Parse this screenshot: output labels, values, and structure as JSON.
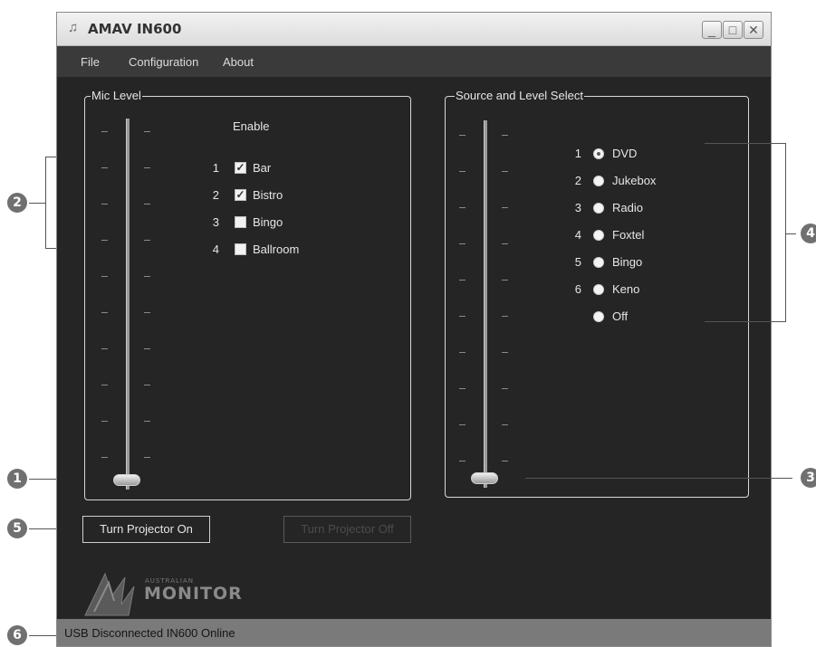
{
  "window": {
    "title": "AMAV IN600",
    "icon": "speaker-icon",
    "controls": [
      "minimize",
      "maximize",
      "close"
    ]
  },
  "menu": [
    "File",
    "Configuration",
    "About"
  ],
  "mic_level": {
    "title": "Mic Level",
    "enable_header": "Enable",
    "level_fraction": 0,
    "channels": [
      {
        "num": "1",
        "label": "Bar",
        "checked": true
      },
      {
        "num": "2",
        "label": "Bistro",
        "checked": true
      },
      {
        "num": "3",
        "label": "Bingo",
        "checked": false
      },
      {
        "num": "4",
        "label": "Ballroom",
        "checked": false
      }
    ]
  },
  "source_level": {
    "title": "Source and Level Select",
    "level_fraction": 0,
    "sources": [
      {
        "num": "1",
        "label": "DVD",
        "selected": true
      },
      {
        "num": "2",
        "label": "Jukebox",
        "selected": false
      },
      {
        "num": "3",
        "label": "Radio",
        "selected": false
      },
      {
        "num": "4",
        "label": "Foxtel",
        "selected": false
      },
      {
        "num": "5",
        "label": "Bingo",
        "selected": false
      },
      {
        "num": "6",
        "label": "Keno",
        "selected": false
      },
      {
        "num": "",
        "label": "Off",
        "selected": false
      }
    ]
  },
  "buttons": {
    "projector_on": "Turn Projector On",
    "projector_off": "Turn Projector Off"
  },
  "logo": {
    "line1": "AUSTRALIAN",
    "line2": "MONITOR"
  },
  "status": {
    "text": "USB Disconnected  IN600 Online"
  },
  "callouts": [
    "1",
    "2",
    "3",
    "4",
    "5",
    "6"
  ],
  "colors": {
    "window_bg": "#252525",
    "status_bg": "#7a7a7a",
    "callout_bg": "#707070"
  }
}
